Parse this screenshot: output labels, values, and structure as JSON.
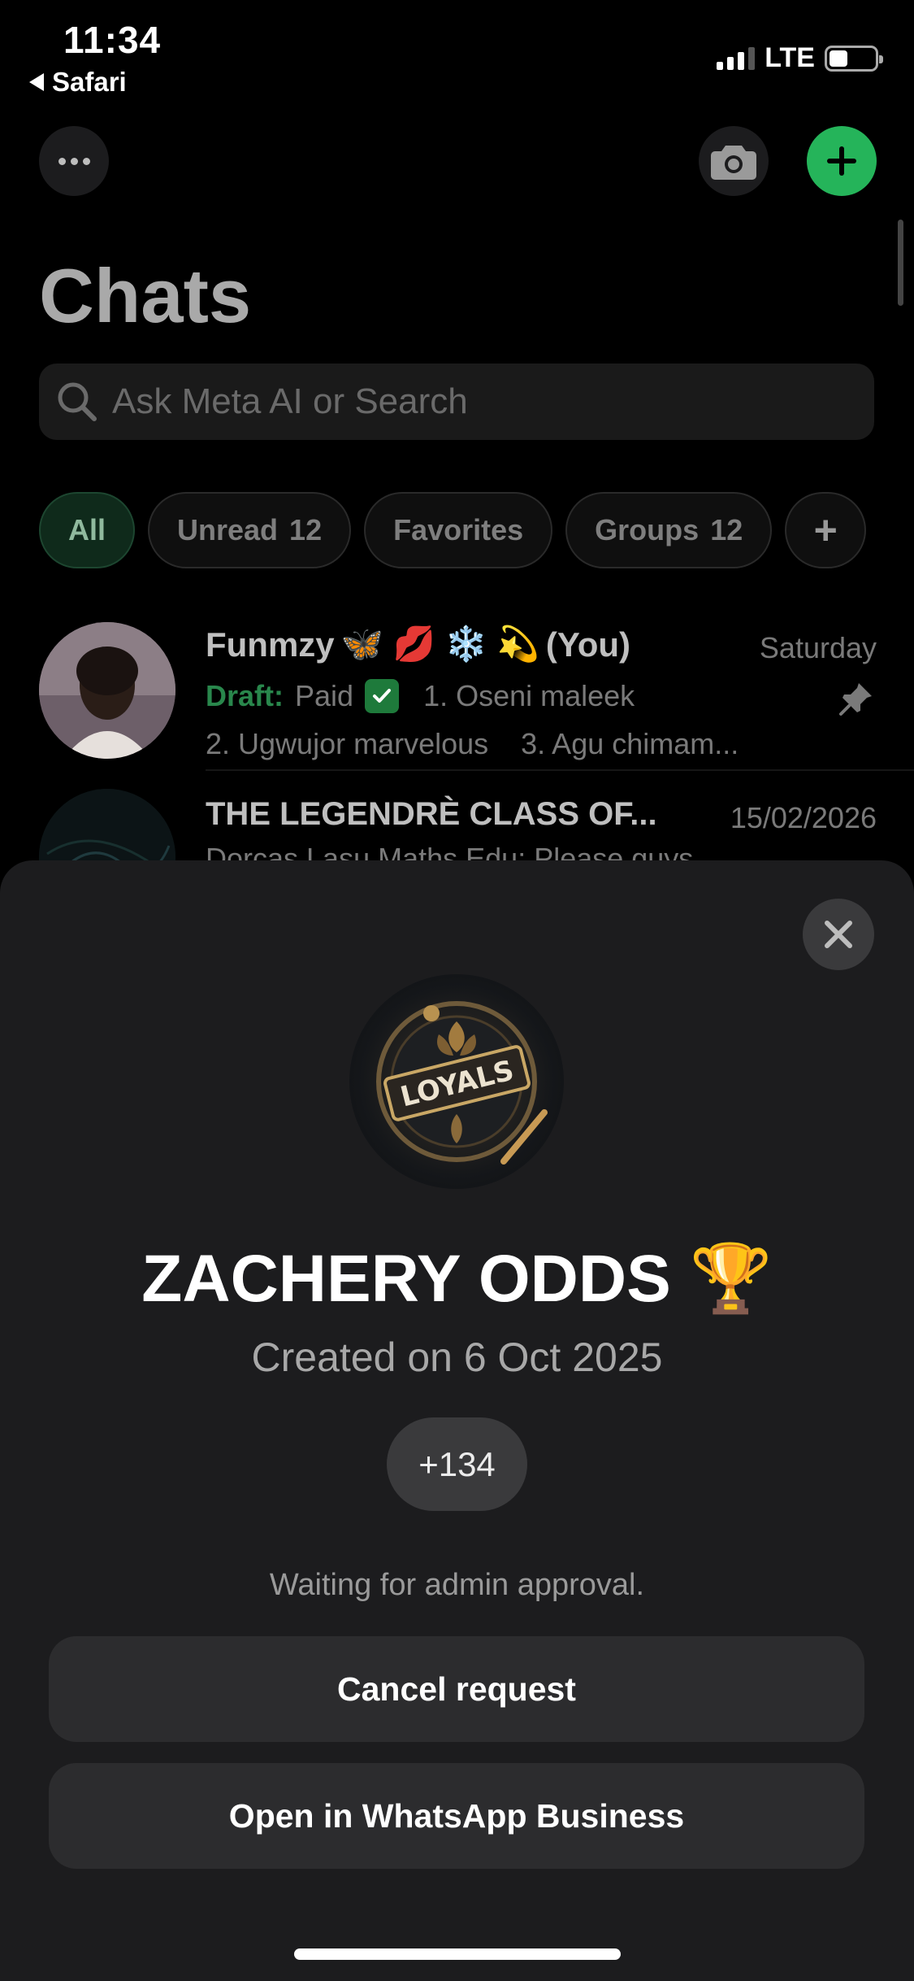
{
  "status_bar": {
    "time": "11:34",
    "back_label": "Safari",
    "network": "LTE",
    "signal_bars": 3,
    "battery_level": 0.4
  },
  "header": {
    "title": "Chats",
    "more_icon": "ellipsis-icon",
    "camera_icon": "camera-icon",
    "new_chat_icon": "plus-icon",
    "accent_color": "#25b45a"
  },
  "search": {
    "placeholder": "Ask Meta AI or Search"
  },
  "filters": [
    {
      "label": "All",
      "count": ""
    },
    {
      "label": "Unread",
      "count": "12"
    },
    {
      "label": "Favorites",
      "count": ""
    },
    {
      "label": "Groups",
      "count": "12"
    }
  ],
  "chats": [
    {
      "name": "Funmzy",
      "name_emojis": "🦋 💋 ❄️ 💫",
      "name_suffix": "(You)",
      "time": "Saturday",
      "draft_label": "Draft:",
      "preview_1": "Paid",
      "preview_1b": "1. Oseni maleek",
      "preview_2": "2. Ugwujor marvelous    3. Agu chimam...",
      "pinned": true
    },
    {
      "name": "THE LEGENDRÈ CLASS OF...",
      "time": "15/02/2026",
      "preview": "Dorcas Lasu Maths Edu: Please guys..."
    }
  ],
  "sheet": {
    "group_avatar_text": "LOYALS",
    "group_name": "ZACHERY ODDS",
    "group_emoji": "🏆",
    "created": "Created on 6 Oct 2025",
    "members": "+134",
    "status": "Waiting for admin approval.",
    "cancel_label": "Cancel request",
    "open_label": "Open in WhatsApp Business"
  }
}
